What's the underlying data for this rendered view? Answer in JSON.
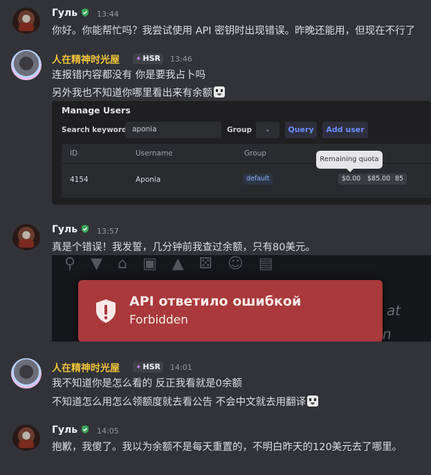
{
  "messages": [
    {
      "author": "Гуль",
      "time": "13:44",
      "lines": [
        "你好。你能帮忙吗？我尝试使用 API 密钥时出现错误。昨晚还能用，但现在不行了"
      ]
    },
    {
      "author": "人在精神时光屋",
      "tag": "HSR",
      "time": "13:46",
      "lines": [
        "连报错内容都没有 你是要我占卜吗",
        "另外我也不知道你哪里看出来有余额"
      ]
    },
    {
      "author": "Гуль",
      "time": "13:57",
      "lines": [
        "真是个错误！我发誓，几分钟前我查过余额，只有80美元。"
      ]
    },
    {
      "author": "人在精神时光屋",
      "tag": "HSR",
      "time": "14:01",
      "lines": [
        "我不知道你是怎么看的 反正我看就是0余额",
        "不知道怎么用怎么领额度就去看公告 不会中文就去用翻译"
      ]
    },
    {
      "author": "Гуль",
      "time": "14:05",
      "lines": [
        "抱歉，我傻了。我以为余额不是每天重置的，不明白昨天的120美元去了哪里。"
      ]
    }
  ],
  "manage_users": {
    "title": "Manage Users",
    "search_label": "Search keywords",
    "search_value": "aponia",
    "group_label": "Group",
    "query_button": "Query",
    "add_button": "Add user",
    "columns": [
      "ID",
      "Username",
      "Group"
    ],
    "row": {
      "id": "4154",
      "username": "Aponia",
      "group": "default",
      "quota_used": "$0.00",
      "quota_total": "$85.00",
      "count": "85"
    },
    "tooltip": "Remaining quota"
  },
  "error_toast": {
    "title": "API ответило ошибкой",
    "subtitle": "Forbidden",
    "bg_text_1": "at",
    "bg_text_2": "n"
  },
  "colors": {
    "accent_name": "#f0c43a",
    "error_bg": "#a9393b",
    "link_blue": "#6f8dff"
  }
}
